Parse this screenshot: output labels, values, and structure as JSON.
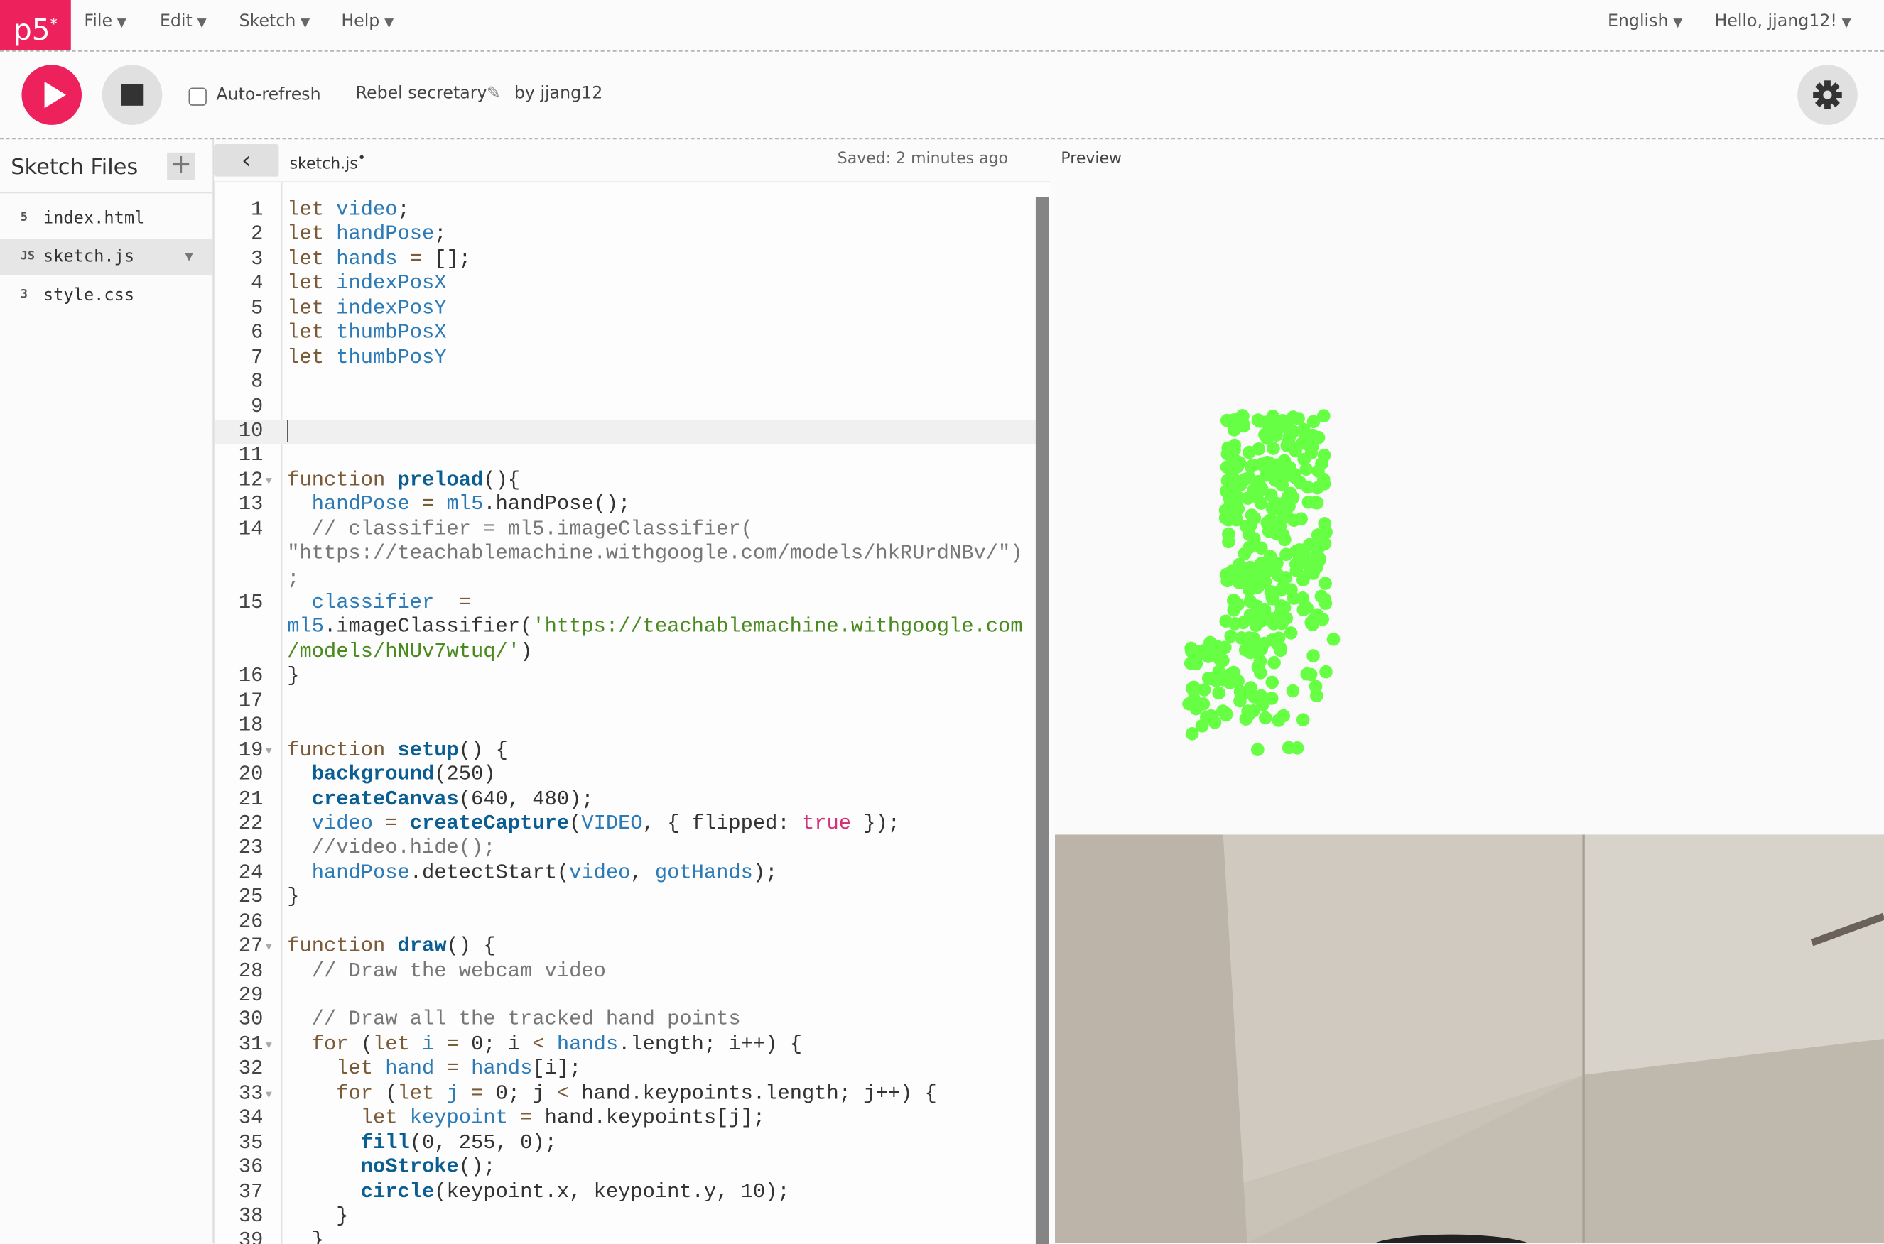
{
  "nav": {
    "logo": "p5*",
    "menus": [
      {
        "label": "File"
      },
      {
        "label": "Edit"
      },
      {
        "label": "Sketch"
      },
      {
        "label": "Help"
      }
    ],
    "language": "English",
    "user": "Hello, jjang12!"
  },
  "toolbar": {
    "auto_refresh_label": "Auto-refresh",
    "auto_refresh_checked": false,
    "sketch_name": "Rebel secretary",
    "author": "by jjang12"
  },
  "sidebar": {
    "title": "Sketch Files",
    "files": [
      {
        "icon": "html5-file-icon",
        "badge": "5",
        "name": "index.html"
      },
      {
        "icon": "js-file-icon",
        "badge": "JS",
        "name": "sketch.js",
        "selected": true
      },
      {
        "icon": "css3-file-icon",
        "badge": "3",
        "name": "style.css"
      }
    ]
  },
  "editor": {
    "tab": "sketch.js",
    "unsaved_marker": "•",
    "saved_status": "Saved: 2 minutes ago",
    "rows": [
      {
        "n": "1",
        "t": [
          [
            "kw",
            "let "
          ],
          [
            "var",
            "video"
          ],
          [
            "pl",
            ";"
          ]
        ]
      },
      {
        "n": "2",
        "t": [
          [
            "kw",
            "let "
          ],
          [
            "var",
            "handPose"
          ],
          [
            "pl",
            ";"
          ]
        ]
      },
      {
        "n": "3",
        "t": [
          [
            "kw",
            "let "
          ],
          [
            "var",
            "hands"
          ],
          [
            "kw",
            " = "
          ],
          [
            "pl",
            "[];"
          ]
        ]
      },
      {
        "n": "4",
        "t": [
          [
            "kw",
            "let "
          ],
          [
            "var",
            "indexPosX"
          ]
        ]
      },
      {
        "n": "5",
        "t": [
          [
            "kw",
            "let "
          ],
          [
            "var",
            "indexPosY"
          ]
        ]
      },
      {
        "n": "6",
        "t": [
          [
            "kw",
            "let "
          ],
          [
            "var",
            "thumbPosX"
          ]
        ]
      },
      {
        "n": "7",
        "t": [
          [
            "kw",
            "let "
          ],
          [
            "var",
            "thumbPosY"
          ]
        ]
      },
      {
        "n": "8",
        "t": []
      },
      {
        "n": "9",
        "t": []
      },
      {
        "n": "10",
        "t": [],
        "active": true
      },
      {
        "n": "11",
        "t": []
      },
      {
        "n": "12",
        "fold": true,
        "t": [
          [
            "kw",
            "function "
          ],
          [
            "fn",
            "preload"
          ],
          [
            "pl",
            "(){"
          ]
        ]
      },
      {
        "n": "13",
        "t": [
          [
            "var",
            "  handPose"
          ],
          [
            "kw",
            " = "
          ],
          [
            "var",
            "ml5"
          ],
          [
            "pl",
            ".handPose();"
          ]
        ]
      },
      {
        "n": "14",
        "t": [
          [
            "cm",
            "  // classifier = ml5.imageClassifier("
          ]
        ]
      },
      {
        "n": "",
        "t": [
          [
            "cm",
            "\"https://teachablemachine.withgoogle.com/models/hkRUrdNBv/\")"
          ]
        ]
      },
      {
        "n": "",
        "t": [
          [
            "cm",
            ";"
          ]
        ]
      },
      {
        "n": "15",
        "t": [
          [
            "var",
            "  classifier"
          ],
          [
            "kw",
            "  ="
          ]
        ]
      },
      {
        "n": "",
        "t": [
          [
            "var",
            "ml5"
          ],
          [
            "pl",
            ".imageClassifier("
          ],
          [
            "str",
            "'https://teachablemachine.withgoogle.com"
          ]
        ]
      },
      {
        "n": "",
        "t": [
          [
            "str",
            "/models/hNUv7wtuq/'"
          ],
          [
            "pl",
            ")"
          ]
        ]
      },
      {
        "n": "16",
        "t": [
          [
            "pl",
            "}"
          ]
        ]
      },
      {
        "n": "17",
        "t": []
      },
      {
        "n": "18",
        "t": []
      },
      {
        "n": "19",
        "fold": true,
        "t": [
          [
            "kw",
            "function "
          ],
          [
            "fn",
            "setup"
          ],
          [
            "pl",
            "() {"
          ]
        ]
      },
      {
        "n": "20",
        "t": [
          [
            "pl",
            "  "
          ],
          [
            "fn",
            "background"
          ],
          [
            "pl",
            "(250)"
          ]
        ]
      },
      {
        "n": "21",
        "t": [
          [
            "pl",
            "  "
          ],
          [
            "fn",
            "createCanvas"
          ],
          [
            "pl",
            "(640, 480);"
          ]
        ]
      },
      {
        "n": "22",
        "t": [
          [
            "var",
            "  video"
          ],
          [
            "kw",
            " = "
          ],
          [
            "fn",
            "createCapture"
          ],
          [
            "pl",
            "("
          ],
          [
            "var",
            "VIDEO"
          ],
          [
            "pl",
            ", { flipped: "
          ],
          [
            "bool",
            "true"
          ],
          [
            "pl",
            " });"
          ]
        ]
      },
      {
        "n": "23",
        "t": [
          [
            "cm",
            "  //video.hide();"
          ]
        ]
      },
      {
        "n": "24",
        "t": [
          [
            "var",
            "  handPose"
          ],
          [
            "pl",
            ".detectStart("
          ],
          [
            "var",
            "video"
          ],
          [
            "pl",
            ", "
          ],
          [
            "var",
            "gotHands"
          ],
          [
            "pl",
            ");"
          ]
        ]
      },
      {
        "n": "25",
        "t": [
          [
            "pl",
            "}"
          ]
        ]
      },
      {
        "n": "26",
        "t": []
      },
      {
        "n": "27",
        "fold": true,
        "t": [
          [
            "kw",
            "function "
          ],
          [
            "fn",
            "draw"
          ],
          [
            "pl",
            "() {"
          ]
        ]
      },
      {
        "n": "28",
        "t": [
          [
            "cm",
            "  // Draw the webcam video"
          ]
        ]
      },
      {
        "n": "29",
        "t": []
      },
      {
        "n": "30",
        "t": [
          [
            "cm",
            "  // Draw all the tracked hand points"
          ]
        ]
      },
      {
        "n": "31",
        "fold": true,
        "t": [
          [
            "kw",
            "  for "
          ],
          [
            "pl",
            "("
          ],
          [
            "kw",
            "let "
          ],
          [
            "var",
            "i"
          ],
          [
            "kw",
            " = "
          ],
          [
            "pl",
            "0; i "
          ],
          [
            "kw",
            "<"
          ],
          [
            "var",
            " hands"
          ],
          [
            "pl",
            ".length; i++) {"
          ]
        ]
      },
      {
        "n": "32",
        "t": [
          [
            "kw",
            "    let "
          ],
          [
            "var",
            "hand"
          ],
          [
            "kw",
            " = "
          ],
          [
            "var",
            "hands"
          ],
          [
            "pl",
            "[i];"
          ]
        ]
      },
      {
        "n": "33",
        "fold": true,
        "t": [
          [
            "kw",
            "    for "
          ],
          [
            "pl",
            "("
          ],
          [
            "kw",
            "let "
          ],
          [
            "var",
            "j"
          ],
          [
            "kw",
            " = "
          ],
          [
            "pl",
            "0; j "
          ],
          [
            "kw",
            "<"
          ],
          [
            "pl",
            " hand.keypoints.length; j++) {"
          ]
        ]
      },
      {
        "n": "34",
        "t": [
          [
            "kw",
            "      let "
          ],
          [
            "var",
            "keypoint"
          ],
          [
            "kw",
            " = "
          ],
          [
            "pl",
            "hand.keypoints[j];"
          ]
        ]
      },
      {
        "n": "35",
        "t": [
          [
            "pl",
            "      "
          ],
          [
            "fn",
            "fill"
          ],
          [
            "pl",
            "(0, 255, 0);"
          ]
        ]
      },
      {
        "n": "36",
        "t": [
          [
            "pl",
            "      "
          ],
          [
            "fn",
            "noStroke"
          ],
          [
            "pl",
            "();"
          ]
        ]
      },
      {
        "n": "37",
        "t": [
          [
            "pl",
            "      "
          ],
          [
            "fn",
            "circle"
          ],
          [
            "pl",
            "(keypoint.x, keypoint.y, 10);"
          ]
        ]
      },
      {
        "n": "38",
        "t": [
          [
            "pl",
            "    }"
          ]
        ]
      },
      {
        "n": "39",
        "t": [
          [
            "pl",
            "  }"
          ]
        ]
      }
    ]
  },
  "preview": {
    "label": "Preview",
    "keypoint_color": "#66ff44"
  },
  "colors": {
    "accent": "#ed225d",
    "button_gray": "#e0e0e0"
  }
}
